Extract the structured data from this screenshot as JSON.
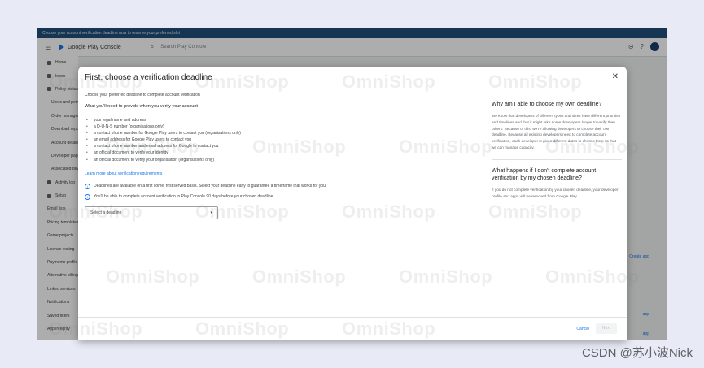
{
  "banner": {
    "text": "Choose your account verification deadline now to reserve your preferred slot"
  },
  "topbar": {
    "logo_text": "Google Play Console",
    "search_placeholder": "Search Play Console"
  },
  "sidebar": {
    "items": [
      "Home",
      "Inbox",
      "Policy status",
      "Users and permissions",
      "Order management",
      "Download reports",
      "Account details",
      "Developer page",
      "Associated developer accounts",
      "Activity log",
      "Setup",
      "Email lists",
      "Pricing templates",
      "Game projects",
      "Licence testing",
      "Payments profile",
      "Alternative billing",
      "Linked services",
      "Notifications",
      "Saved filters",
      "App integrity"
    ]
  },
  "background_links": {
    "create_app": "Create app",
    "app1": "app",
    "app2": "app"
  },
  "modal": {
    "title": "First, choose a verification deadline",
    "intro": "Choose your preferred deadline to complete account verification",
    "requirements_heading": "What you'll need to provide when you verify your account",
    "requirements": [
      "your legal name and address",
      "a D-U-N-S number (organisations only)",
      "a contact phone number for Google Play users to contact you (organisations only)",
      "an email address for Google Play users to contact you",
      "a contact phone number and email address for Google to contact you",
      "an official document to verify your identity",
      "an official document to verify your organisation (organisations only)"
    ],
    "learn_more": "Learn more about verification requirements",
    "info1": "Deadlines are available on a first come, first served basis. Select your deadline early to guarantee a timeframe that works for you.",
    "info2": "You'll be able to complete account verification in Play Console 90 days before your chosen deadline",
    "select_placeholder": "Select a deadline",
    "faq": [
      {
        "q": "Why am I able to choose my own deadline?",
        "a": "We know that developers of different types and sizes have different priorities and timelines and that it might take some developers longer to verify than others. Because of this, we're allowing developers to choose their own deadline. Because all existing developers need to complete account verification, each developer is given different dates to choose from so that we can manage capacity."
      },
      {
        "q": "What happens if I don't complete account verification by my chosen deadline?",
        "a": "If you do not complete verification by your chosen deadline, your developer profile and apps will be removed from Google Play."
      }
    ],
    "cancel": "Cancel",
    "next": "Next"
  },
  "watermark": "OmniShop",
  "credit": "CSDN @苏小波Nick"
}
